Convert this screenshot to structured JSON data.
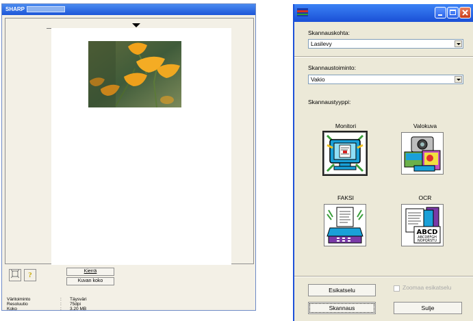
{
  "left_window": {
    "title": "SHARP",
    "rotate_button": "Kierrä",
    "image_size_button": "Kuvan koko",
    "info": [
      {
        "key": "Väritoiminto",
        "sep": ":",
        "value": "Täysväri"
      },
      {
        "key": "Resoluutio",
        "sep": ":",
        "value": "75dpi"
      },
      {
        "key": "Koko",
        "sep": ":",
        "value": "3.20 MB"
      }
    ],
    "icons": {
      "fit": "fit-page-icon",
      "help": "help-icon"
    }
  },
  "dialog": {
    "scan_source_label": "Skannauskohta:",
    "scan_source_value": "Lasilevy",
    "scan_mode_label": "Skannaustoiminto:",
    "scan_mode_value": "Vakio",
    "scan_type_label": "Skannaustyyppi:",
    "types": [
      {
        "label": "Monitori",
        "icon": "monitor-icon",
        "selected": true
      },
      {
        "label": "Valokuva",
        "icon": "photo-icon",
        "selected": false
      },
      {
        "label": "FAKSI",
        "icon": "fax-icon",
        "selected": false
      },
      {
        "label": "OCR",
        "icon": "ocr-icon",
        "selected": false
      }
    ],
    "ocr_sample_big": "ABCD",
    "ocr_sample_line1": "ABCDEFGH",
    "ocr_sample_line2": "NOPQRSTU",
    "preview_button": "Esikatselu",
    "zoom_preview_label": "Zoomaa esikatselu",
    "scan_button": "Skannaus",
    "close_button": "Sulje"
  }
}
